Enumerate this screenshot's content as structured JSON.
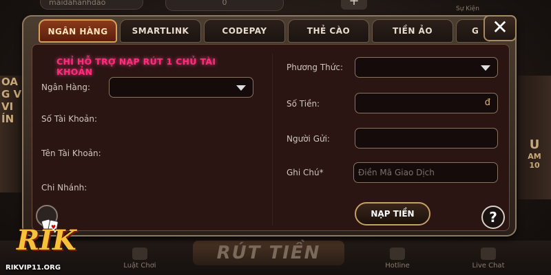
{
  "background": {
    "username": "maidahanhdao",
    "coins": "0",
    "event_label": "Sự Kiện",
    "left_banner": [
      "OA",
      "G V",
      "VI",
      "ÍN"
    ],
    "right_banner": [
      "U",
      "AM",
      "10"
    ],
    "rut_tien": "RÚT TIỀN",
    "nav": {
      "luat_choi": "Luật Chơi",
      "hotline": "Hotline",
      "live_chat": "Live Chat"
    }
  },
  "logo": {
    "brand": "RIK",
    "url": "RIKVIP11.ORG"
  },
  "tabs": [
    {
      "label": "NGÂN HÀNG",
      "active": true
    },
    {
      "label": "SMARTLINK",
      "active": false
    },
    {
      "label": "CODEPAY",
      "active": false
    },
    {
      "label": "THẺ CÀO",
      "active": false
    },
    {
      "label": "TIỀN ẢO",
      "active": false
    },
    {
      "label": "G",
      "active": false
    }
  ],
  "close_label": "✕",
  "form": {
    "notice": "CHỈ HỖ TRỢ NẠP RÚT 1 CHỦ TÀI KHOẢN",
    "left": {
      "bank_label": "Ngân Hàng:",
      "account_no_label": "Số Tài Khoản:",
      "account_name_label": "Tên Tài Khoản:",
      "branch_label": "Chi Nhánh:"
    },
    "right": {
      "method_label": "Phương Thức:",
      "amount_label": "Số Tiền:",
      "currency_symbol": "đ",
      "sender_label": "Người Gửi:",
      "note_label": "Ghi Chú*",
      "note_placeholder": "Điền Mã Giao Dịch"
    },
    "submit_label": "NẠP TIỀN",
    "help_label": "?"
  },
  "colors": {
    "accent": "#d6a05a",
    "notice": "#ff2c7a",
    "panel": "#2a1513"
  }
}
